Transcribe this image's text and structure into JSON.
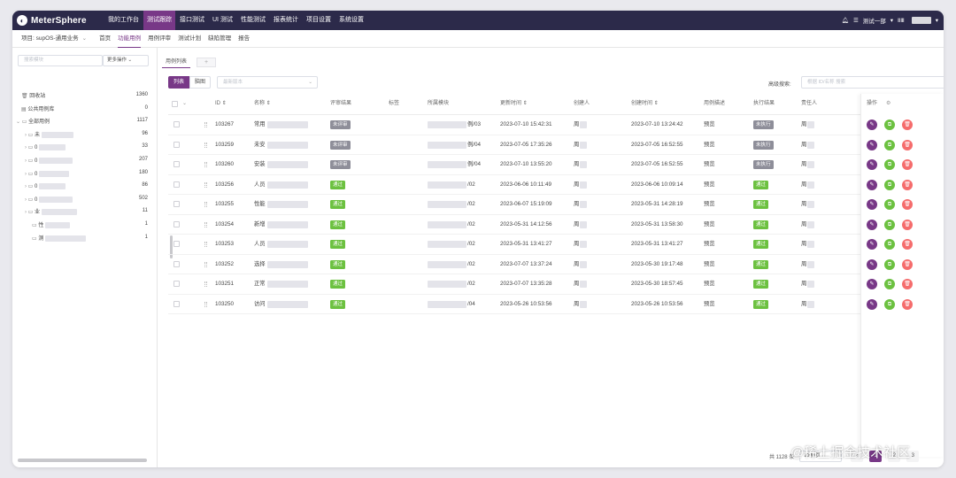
{
  "app": {
    "logo": "MeterSphere"
  },
  "topnav": {
    "items": [
      "我的工作台",
      "测试跟踪",
      "接口测试",
      "UI 测试",
      "性能测试",
      "报表统计",
      "项目设置",
      "系统设置"
    ],
    "active_index": 1,
    "workspace": "测试一部",
    "lang": "ⅡⅢ"
  },
  "subnav": {
    "project_label": "项目: supOS-通用业务",
    "items": [
      "首页",
      "功能用例",
      "用例评审",
      "测试计划",
      "缺陷管理",
      "报告"
    ],
    "active_index": 1
  },
  "sidebar": {
    "search_placeholder": "搜索模块",
    "more_label": "更多操作",
    "tree": [
      {
        "label": "回收站",
        "count": "1360"
      },
      {
        "label": "公共用例库",
        "count": "0"
      },
      {
        "label": "全部用例",
        "count": "1117"
      },
      {
        "label": "未",
        "count": "96"
      },
      {
        "label": "0",
        "count": "33"
      },
      {
        "label": "0",
        "count": "207"
      },
      {
        "label": "0",
        "count": "180"
      },
      {
        "label": "0",
        "count": "86"
      },
      {
        "label": "0",
        "count": "502"
      },
      {
        "label": "业",
        "count": "11"
      },
      {
        "label": "性",
        "count": "1"
      },
      {
        "label": "测",
        "count": "1"
      }
    ]
  },
  "main": {
    "tab_label": "用例列表",
    "tab_add": "+",
    "view_list": "列表",
    "view_mind": "脑图",
    "version_placeholder": "最新版本",
    "adv_search_label": "高级搜索:",
    "adv_search_placeholder": "根据 ID/名称 搜索"
  },
  "table": {
    "headers": {
      "id": "ID",
      "name": "名称",
      "review": "评审结果",
      "tags": "标签",
      "module": "所属模块",
      "updated": "更新时间",
      "creator": "创建人",
      "created": "创建时间",
      "desc": "用例描述",
      "exec": "执行结果",
      "owner": "责任人",
      "ops": "操作"
    },
    "rows": [
      {
        "id": "103267",
        "name": "常用",
        "review": "未评审",
        "module_tail": "例/03",
        "updated": "2023-07-10 15:42:31",
        "creator": "周",
        "created": "2023-07-10 13:24:42",
        "desc": "预览",
        "exec": "未执行",
        "owner": "周"
      },
      {
        "id": "103259",
        "name": "未安",
        "review": "未评审",
        "module_tail": "例/04",
        "updated": "2023-07-05 17:35:26",
        "creator": "周",
        "created": "2023-07-05 16:52:55",
        "desc": "预览",
        "exec": "未执行",
        "owner": "周"
      },
      {
        "id": "103260",
        "name": "安装",
        "review": "未评审",
        "module_tail": "例/04",
        "updated": "2023-07-10 13:55:20",
        "creator": "周",
        "created": "2023-07-05 16:52:55",
        "desc": "预览",
        "exec": "未执行",
        "owner": "周"
      },
      {
        "id": "103256",
        "name": "人员",
        "review": "通过",
        "module_tail": "/02",
        "updated": "2023-06-06 10:11:49",
        "creator": "周",
        "created": "2023-06-06 10:09:14",
        "desc": "预览",
        "exec": "通过",
        "owner": "周"
      },
      {
        "id": "103255",
        "name": "性能",
        "review": "通过",
        "module_tail": "/02",
        "updated": "2023-06-07 15:19:09",
        "creator": "周",
        "created": "2023-05-31 14:28:19",
        "desc": "预览",
        "exec": "通过",
        "owner": "周"
      },
      {
        "id": "103254",
        "name": "新增",
        "review": "通过",
        "module_tail": "/02",
        "updated": "2023-05-31 14:12:56",
        "creator": "周",
        "created": "2023-05-31 13:58:30",
        "desc": "预览",
        "exec": "通过",
        "owner": "周"
      },
      {
        "id": "103253",
        "name": "人员",
        "review": "通过",
        "module_tail": "/02",
        "updated": "2023-05-31 13:41:27",
        "creator": "周",
        "created": "2023-05-31 13:41:27",
        "desc": "预览",
        "exec": "通过",
        "owner": "周"
      },
      {
        "id": "103252",
        "name": "选择",
        "review": "通过",
        "module_tail": "/02",
        "updated": "2023-07-07 13:37:24",
        "creator": "周",
        "created": "2023-05-30 19:17:48",
        "desc": "预览",
        "exec": "通过",
        "owner": "周"
      },
      {
        "id": "103251",
        "name": "正常",
        "review": "通过",
        "module_tail": "/02",
        "updated": "2023-07-07 13:35:28",
        "creator": "周",
        "created": "2023-05-30 18:57:45",
        "desc": "预览",
        "exec": "通过",
        "owner": "周"
      },
      {
        "id": "103250",
        "name": "访问",
        "review": "通过",
        "module_tail": "/04",
        "updated": "2023-05-26 10:53:56",
        "creator": "周",
        "created": "2023-05-26 10:53:56",
        "desc": "预览",
        "exec": "通过",
        "owner": "周"
      }
    ]
  },
  "pager": {
    "total": "共 1128 条",
    "page_size": "10条/页",
    "pages": [
      "1",
      "2",
      "3"
    ],
    "current": "1"
  },
  "watermark": "@稀土掘金技术社区",
  "colors": {
    "brand": "#783887",
    "nav_bg": "#2c2a4a",
    "pass": "#6cc140",
    "pending": "#8e8e99",
    "danger": "#f56c6c"
  },
  "icons": {
    "bell": "bell-icon",
    "menu": "menu-icon",
    "edit": "edit-icon",
    "copy": "copy-icon",
    "delete": "delete-icon",
    "settings": "gear-icon"
  }
}
